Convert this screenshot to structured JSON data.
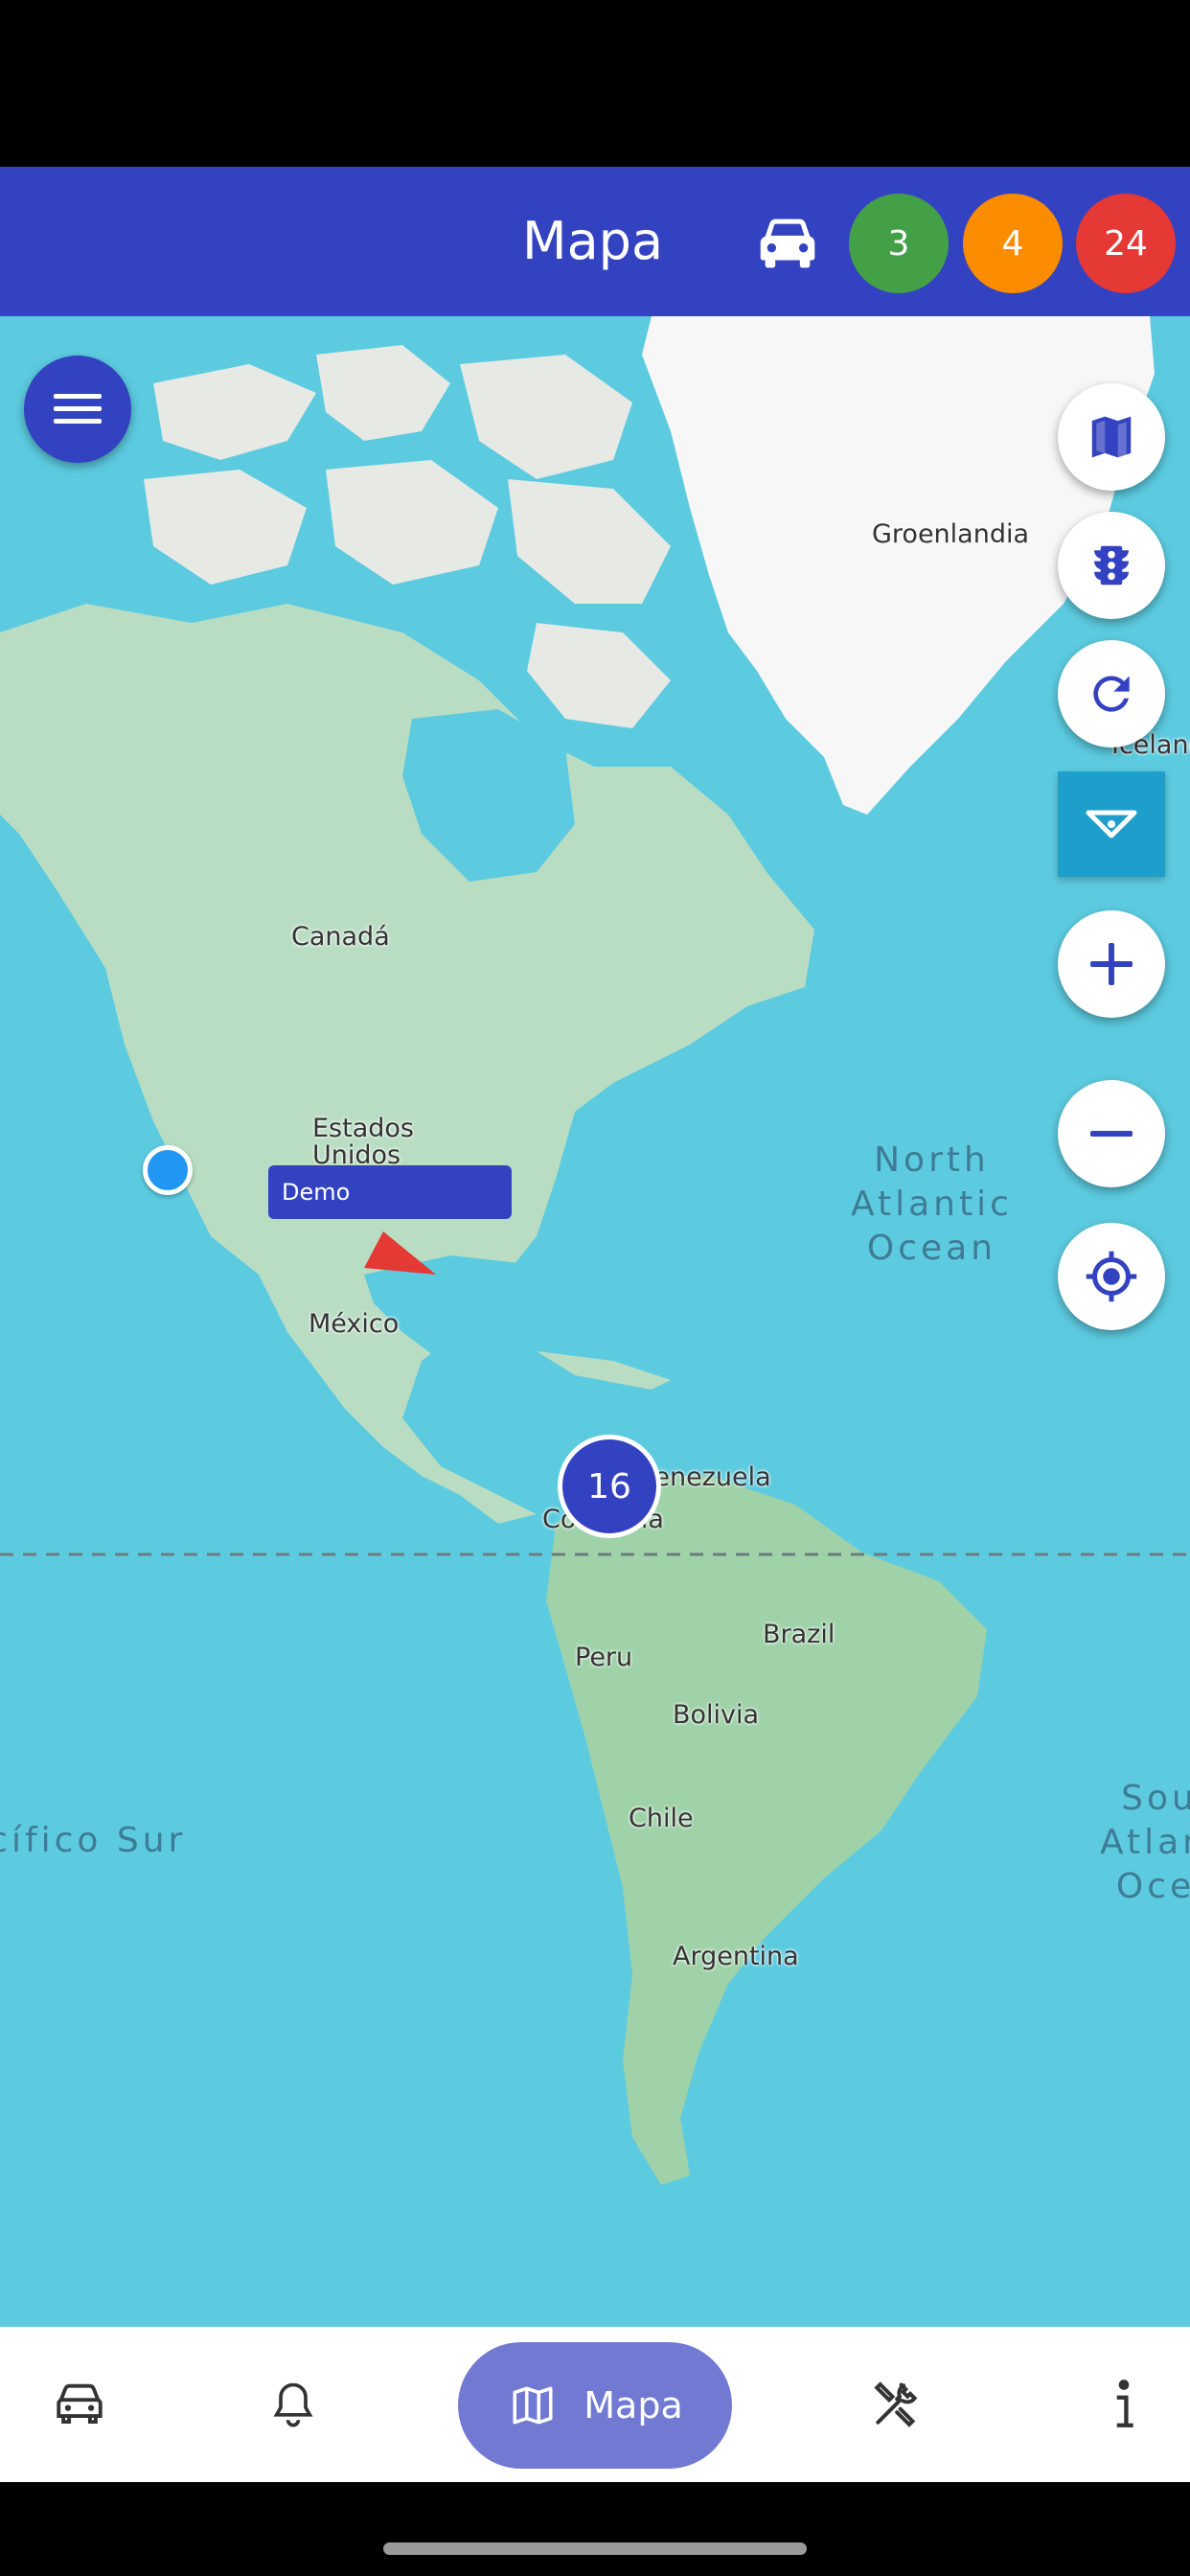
{
  "appbar": {
    "title": "Mapa",
    "counts": [
      {
        "value": "3",
        "color": "#43A047"
      },
      {
        "value": "4",
        "color": "#FB8C00"
      },
      {
        "value": "24",
        "color": "#E53935"
      }
    ]
  },
  "map": {
    "labels": {
      "greenland": "Groenlandia",
      "iceland": "Iceland",
      "canada": "Canadá",
      "usa": "Estados\nUnidos",
      "mexico": "México",
      "venezuela": "Venezuela",
      "colombia": "Colombia",
      "brazil": "Brazil",
      "peru": "Peru",
      "bolivia": "Bolivia",
      "chile": "Chile",
      "argentina": "Argentina",
      "north_atlantic": "North\nAtlantic\nOcean",
      "south_atlantic": "South\nAtlantic\nOcean",
      "south_pacific": "Pacífico Sur"
    },
    "device_tag": "Demo",
    "cluster_count": "16"
  },
  "controls": [
    "map-layers",
    "traffic",
    "refresh",
    "filter",
    "zoom-in",
    "zoom-out",
    "my-location"
  ],
  "bottomnav": {
    "active_label": "Mapa",
    "items": [
      "devices",
      "notifications",
      "map",
      "maintenance",
      "info"
    ]
  }
}
